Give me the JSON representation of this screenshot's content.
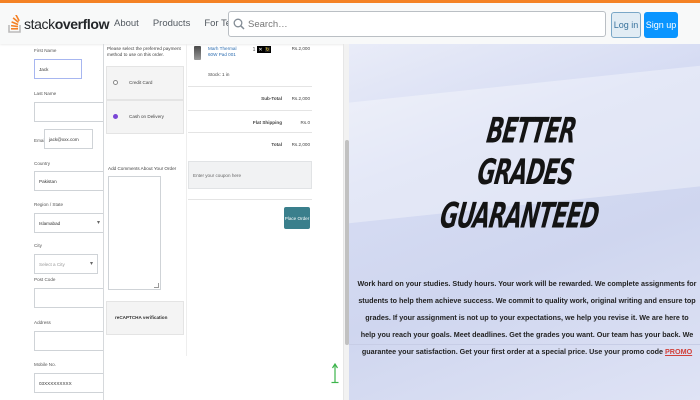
{
  "topbar": {
    "logo_prefix": "stack",
    "logo_suffix": "overflow",
    "nav": [
      "About",
      "Products",
      "For Teams"
    ],
    "search_placeholder": "Search…",
    "login_label": "Log in",
    "signup_label": "Sign up",
    "accent_color": "#f48225",
    "signup_color": "#0a95ff"
  },
  "checkout": {
    "fields": [
      {
        "label": "First Name",
        "value": "Jack"
      },
      {
        "label": "Last Name",
        "value": ""
      },
      {
        "label": "Email",
        "value": "jack@xxx.com"
      },
      {
        "label": "Country",
        "value": "Pakistan"
      },
      {
        "label": "Region / State",
        "value": "Islamabad"
      },
      {
        "label": "City",
        "value": "Select a City"
      },
      {
        "label": "Post Code",
        "value": ""
      },
      {
        "label": "Address",
        "value": ""
      },
      {
        "label": "Mobile No.",
        "value": "03XXXXXXXXX"
      }
    ],
    "payment_heading": "Please select the preferred payment method to use on this order.",
    "payment_options": [
      {
        "label": "Credit Card",
        "selected": false
      },
      {
        "label": "Cash on Delivery",
        "selected": true
      }
    ],
    "comments_label": "Add Comments About Your Order",
    "captcha_label": "reCAPTCHA verification",
    "product": {
      "name": "Marh Thermal 60W Pad 001",
      "stock": "Stock: 1 in",
      "quantity": "1",
      "price": "Rs.2,000"
    },
    "summary": [
      {
        "key": "Sub-Total",
        "value": "Rs.2,000"
      },
      {
        "key": "Flat Shipping",
        "value": "Rs.0"
      },
      {
        "key": "Total",
        "value": "Rs.2,000"
      }
    ],
    "coupon_placeholder": "Enter your coupon here",
    "place_order_label": "Place Order"
  },
  "hero": {
    "title": "BETTER GRADES GUARANTEED",
    "body": "Work hard on your studies. Study hours. Your work will be rewarded. We complete assignments for students to help them achieve success. We commit to quality work, original writing and ensure top grades. If your assignment is not up to your expectations, we help you revise it. We are here to help you reach your goals. Meet deadlines. Get the grades you want. Our team has your back. We guarantee your satisfaction. Get your first order at a special price. Use your promo code",
    "promo": "PROMO",
    "panel_color": "#d6dcf3"
  }
}
